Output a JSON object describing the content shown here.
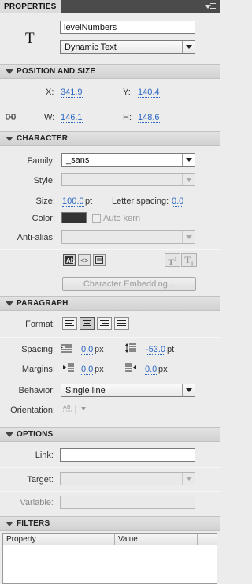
{
  "panel": {
    "tab_label": "PROPERTIES",
    "menu_icon": "panel-menu-icon"
  },
  "instance": {
    "type_glyph": "T",
    "name_value": "levelNumbers",
    "text_type": "Dynamic Text"
  },
  "position_size": {
    "title": "POSITION AND SIZE",
    "x_label": "X:",
    "x_value": "341.9",
    "y_label": "Y:",
    "y_value": "140.4",
    "w_label": "W:",
    "w_value": "146.1",
    "h_label": "H:",
    "h_value": "148.6",
    "lock_icon": "link-icon"
  },
  "character": {
    "title": "CHARACTER",
    "family_label": "Family:",
    "family_value": "_sans",
    "style_label": "Style:",
    "style_value": "",
    "size_label": "Size:",
    "size_value": "100.0",
    "size_unit": "pt",
    "letter_spacing_label": "Letter spacing:",
    "letter_spacing_value": "0.0",
    "color_label": "Color:",
    "color_value": "#333333",
    "auto_kern_label": "Auto kern",
    "anti_alias_label": "Anti-alias:",
    "anti_alias_value": "",
    "superscript_glyph": "T",
    "subscript_glyph": "T",
    "embedding_button": "Character Embedding..."
  },
  "paragraph": {
    "title": "PARAGRAPH",
    "format_label": "Format:",
    "spacing_label": "Spacing:",
    "indent_value": "0.0",
    "indent_unit": "px",
    "line_spacing_value": "-53.0",
    "line_spacing_unit": "pt",
    "margins_label": "Margins:",
    "left_margin_value": "0.0",
    "left_margin_unit": "px",
    "right_margin_value": "0.0",
    "right_margin_unit": "px",
    "behavior_label": "Behavior:",
    "behavior_value": "Single line",
    "orientation_label": "Orientation:"
  },
  "options": {
    "title": "OPTIONS",
    "link_label": "Link:",
    "link_value": "",
    "target_label": "Target:",
    "target_value": "",
    "variable_label": "Variable:",
    "variable_value": ""
  },
  "filters": {
    "title": "FILTERS",
    "col_property": "Property",
    "col_value": "Value"
  }
}
